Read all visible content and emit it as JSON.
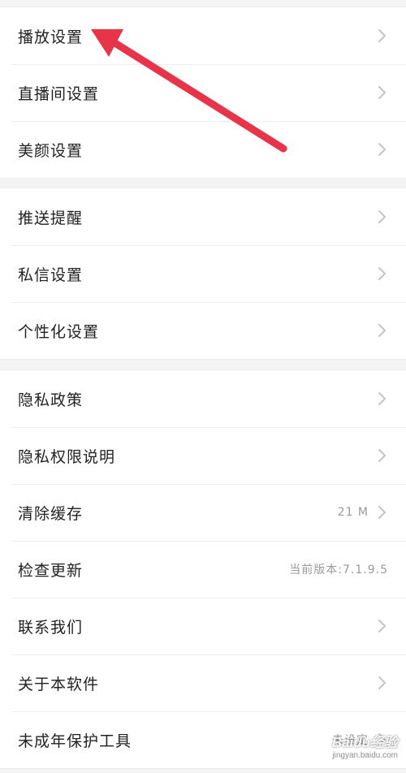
{
  "groups": [
    {
      "rows": [
        {
          "label": "播放设置",
          "value": ""
        },
        {
          "label": "直播间设置",
          "value": ""
        },
        {
          "label": "美颜设置",
          "value": ""
        }
      ]
    },
    {
      "rows": [
        {
          "label": "推送提醒",
          "value": ""
        },
        {
          "label": "私信设置",
          "value": ""
        },
        {
          "label": "个性化设置",
          "value": ""
        }
      ]
    },
    {
      "rows": [
        {
          "label": "隐私政策",
          "value": ""
        },
        {
          "label": "隐私权限说明",
          "value": ""
        },
        {
          "label": "清除缓存",
          "value": "21 M"
        },
        {
          "label": "检查更新",
          "value": "当前版本:7.1.9.5"
        },
        {
          "label": "联系我们",
          "value": ""
        },
        {
          "label": "关于本软件",
          "value": ""
        },
        {
          "label": "未成年保护工具",
          "value": "未设定"
        }
      ]
    }
  ],
  "annotation": {
    "arrow_color": "#e8344a"
  },
  "watermark": {
    "main": "Baidu经验",
    "sub": "jingyan.baidu.com"
  },
  "colors": {
    "chevron": "#c4c4c4",
    "divider": "#ededed",
    "background": "#f4f4f4"
  }
}
